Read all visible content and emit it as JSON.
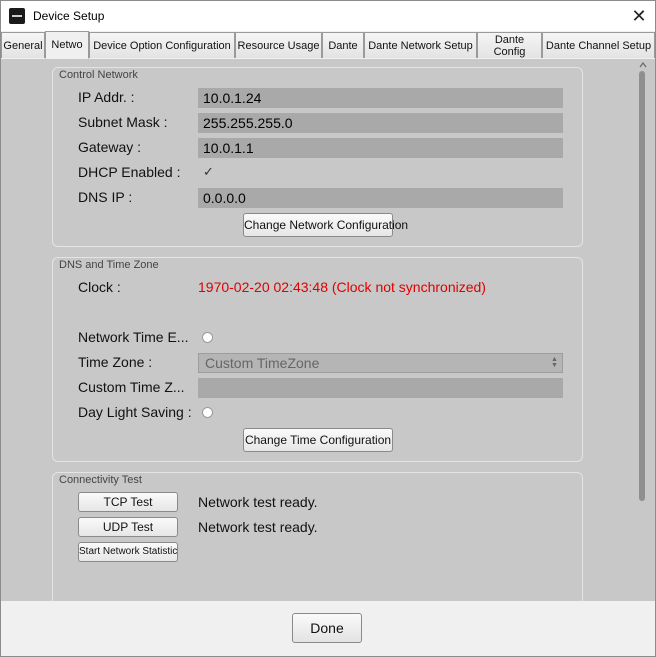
{
  "window": {
    "title": "Device Setup",
    "icon": "app-logo-icon",
    "close_glyph": "✕"
  },
  "tabs": [
    {
      "label": "General"
    },
    {
      "label": "Netwo",
      "active": true
    },
    {
      "label": "Device Option Configuration"
    },
    {
      "label": "Resource Usage"
    },
    {
      "label": "Dante"
    },
    {
      "label": "Dante Network Setup"
    },
    {
      "label": "Dante Config"
    },
    {
      "label": "Dante Channel Setup"
    }
  ],
  "control_network": {
    "title": "Control Network",
    "ip_label": "IP Addr. :",
    "ip_value": "10.0.1.24",
    "subnet_label": "Subnet Mask :",
    "subnet_value": "255.255.255.0",
    "gateway_label": "Gateway :",
    "gateway_value": "10.0.1.1",
    "dhcp_label": "DHCP Enabled :",
    "dhcp_checked": true,
    "dhcp_glyph": "✓",
    "dns_label": "DNS IP :",
    "dns_value": "0.0.0.0",
    "change_button": "Change Network Configuration"
  },
  "dns_time": {
    "title": "DNS and Time Zone",
    "clock_label": "Clock :",
    "clock_value": "1970-02-20 02:43:48 (Clock not synchronized)",
    "clock_color": "#e00000",
    "ntp_label": "Network Time E...",
    "ntp_enabled": false,
    "timezone_label": "Time Zone :",
    "timezone_value": "Custom TimeZone",
    "custom_tz_label": "Custom Time Z...",
    "custom_tz_value": "",
    "dst_label": "Day Light Saving :",
    "dst_enabled": false,
    "change_button": "Change Time Configuration"
  },
  "connectivity": {
    "title": "Connectivity Test",
    "tcp_button": "TCP Test",
    "tcp_status": "Network test ready.",
    "udp_button": "UDP Test",
    "udp_status": "Network test ready.",
    "stat_button": "Start Network Statistic"
  },
  "footer": {
    "done_button": "Done"
  }
}
